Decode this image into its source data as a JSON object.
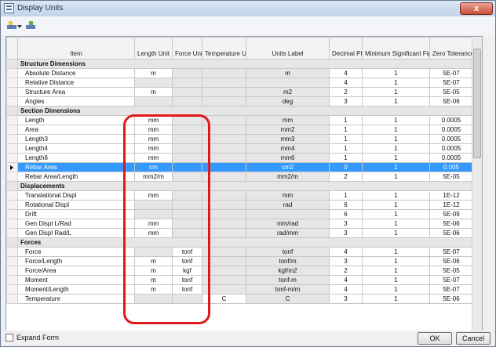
{
  "window": {
    "title": "Display Units",
    "close_label": "x"
  },
  "toolbar": {
    "tools": [
      {
        "icon": "units-settings-icon"
      },
      {
        "icon": "units-edit-icon"
      }
    ]
  },
  "grid": {
    "headers": [
      "Item",
      "Length Unit",
      "Force Unit",
      "Temperature Unit",
      "Units Label",
      "Decimal Places",
      "Minimum Significant Figures",
      "Zero Tolerance"
    ],
    "rows": [
      {
        "type": "section",
        "label": "Structure Dimensions"
      },
      {
        "item": "Absolute Distance",
        "length": "m",
        "force": "",
        "temp": "",
        "label": "m",
        "dec": "4",
        "min": "1",
        "tol": "5E-07"
      },
      {
        "item": "Relative Distance",
        "length": "",
        "force": "",
        "temp": "",
        "label": "",
        "dec": "4",
        "min": "1",
        "tol": "5E-07"
      },
      {
        "item": "Structure Area",
        "length": "m",
        "force": "",
        "temp": "",
        "label": "m2",
        "dec": "2",
        "min": "1",
        "tol": "5E-05"
      },
      {
        "item": "Angles",
        "length": "",
        "force": "",
        "temp": "",
        "label": "deg",
        "dec": "3",
        "min": "1",
        "tol": "5E-06"
      },
      {
        "type": "section",
        "label": "Section Dimensions"
      },
      {
        "item": "Length",
        "length": "mm",
        "force": "",
        "temp": "",
        "label": "mm",
        "dec": "1",
        "min": "1",
        "tol": "0.0005"
      },
      {
        "item": "Area",
        "length": "mm",
        "force": "",
        "temp": "",
        "label": "mm2",
        "dec": "1",
        "min": "1",
        "tol": "0.0005"
      },
      {
        "item": "Length3",
        "length": "mm",
        "force": "",
        "temp": "",
        "label": "mm3",
        "dec": "1",
        "min": "1",
        "tol": "0.0005"
      },
      {
        "item": "Length4",
        "length": "mm",
        "force": "",
        "temp": "",
        "label": "mm4",
        "dec": "1",
        "min": "1",
        "tol": "0.0005"
      },
      {
        "item": "Length6",
        "length": "mm",
        "force": "",
        "temp": "",
        "label": "mm6",
        "dec": "1",
        "min": "1",
        "tol": "0.0005"
      },
      {
        "item": "Rebar Area",
        "length": "cm",
        "force": "",
        "temp": "",
        "label": "cm2",
        "dec": "0",
        "min": "1",
        "tol": "0.005",
        "selected": true
      },
      {
        "item": "Rebar Area/Length",
        "length": "mm2/m",
        "force": "",
        "temp": "",
        "label": "mm2/m",
        "dec": "2",
        "min": "1",
        "tol": "5E-05"
      },
      {
        "type": "section",
        "label": "Displacements"
      },
      {
        "item": "Translational Displ",
        "length": "mm",
        "force": "",
        "temp": "",
        "label": "mm",
        "dec": "1",
        "min": "1",
        "tol": "1E-12"
      },
      {
        "item": "Rotational Displ",
        "length": "",
        "force": "",
        "temp": "",
        "label": "rad",
        "dec": "6",
        "min": "1",
        "tol": "1E-12"
      },
      {
        "item": "Drift",
        "length": "",
        "force": "",
        "temp": "",
        "label": "",
        "dec": "6",
        "min": "1",
        "tol": "5E-09"
      },
      {
        "item": "Gen Displ L/Rad",
        "length": "mm",
        "force": "",
        "temp": "",
        "label": "mm/rad",
        "dec": "3",
        "min": "1",
        "tol": "5E-06"
      },
      {
        "item": "Gen Displ Rad/L",
        "length": "mm",
        "force": "",
        "temp": "",
        "label": "rad/mm",
        "dec": "3",
        "min": "1",
        "tol": "5E-06"
      },
      {
        "type": "section",
        "label": "Forces"
      },
      {
        "item": "Force",
        "length": "",
        "force": "tonf",
        "temp": "",
        "label": "tonf",
        "dec": "4",
        "min": "1",
        "tol": "5E-07"
      },
      {
        "item": "Force/Length",
        "length": "m",
        "force": "tonf",
        "temp": "",
        "label": "tonf/m",
        "dec": "3",
        "min": "1",
        "tol": "5E-06"
      },
      {
        "item": "Force/Area",
        "length": "m",
        "force": "kgf",
        "temp": "",
        "label": "kgf/m2",
        "dec": "2",
        "min": "1",
        "tol": "5E-05"
      },
      {
        "item": "Moment",
        "length": "m",
        "force": "tonf",
        "temp": "",
        "label": "tonf-m",
        "dec": "4",
        "min": "1",
        "tol": "5E-07"
      },
      {
        "item": "Moment/Length",
        "length": "m",
        "force": "tonf",
        "temp": "",
        "label": "tonf-m/m",
        "dec": "4",
        "min": "1",
        "tol": "5E-07"
      },
      {
        "item": "Temperature",
        "length": "",
        "force": "",
        "temp": "C",
        "label": "C",
        "dec": "3",
        "min": "1",
        "tol": "5E-06"
      }
    ]
  },
  "footer": {
    "expand_form_label": "Expand Form",
    "ok_label": "OK",
    "cancel_label": "Cancel"
  },
  "colors": {
    "selection": "#3399ff",
    "highlight": "#e01a1a",
    "section_bg": "#e6e6e6"
  }
}
